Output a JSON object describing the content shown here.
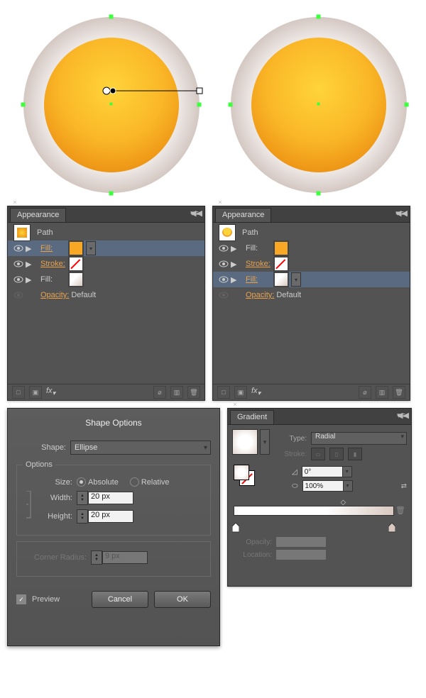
{
  "appearance": {
    "title": "Appearance",
    "path_label": "Path",
    "fill_label": "Fill:",
    "stroke_label": "Stroke:",
    "opacity_label": "Opacity:",
    "opacity_value": "Default"
  },
  "shapeOptions": {
    "title": "Shape Options",
    "shape_label": "Shape:",
    "shape_value": "Ellipse",
    "group_title": "Options",
    "size_label": "Size:",
    "absolute": "Absolute",
    "relative": "Relative",
    "width_label": "Width:",
    "width_value": "20 px",
    "height_label": "Height:",
    "height_value": "20 px",
    "corner_label": "Corner Radius:",
    "corner_value": "9 px",
    "preview": "Preview",
    "cancel": "Cancel",
    "ok": "OK"
  },
  "gradient": {
    "title": "Gradient",
    "type_label": "Type:",
    "type_value": "Radial",
    "stroke_label": "Stroke:",
    "angle_value": "0°",
    "aspect_value": "100%",
    "opacity_label": "Opacity:",
    "location_label": "Location:"
  }
}
